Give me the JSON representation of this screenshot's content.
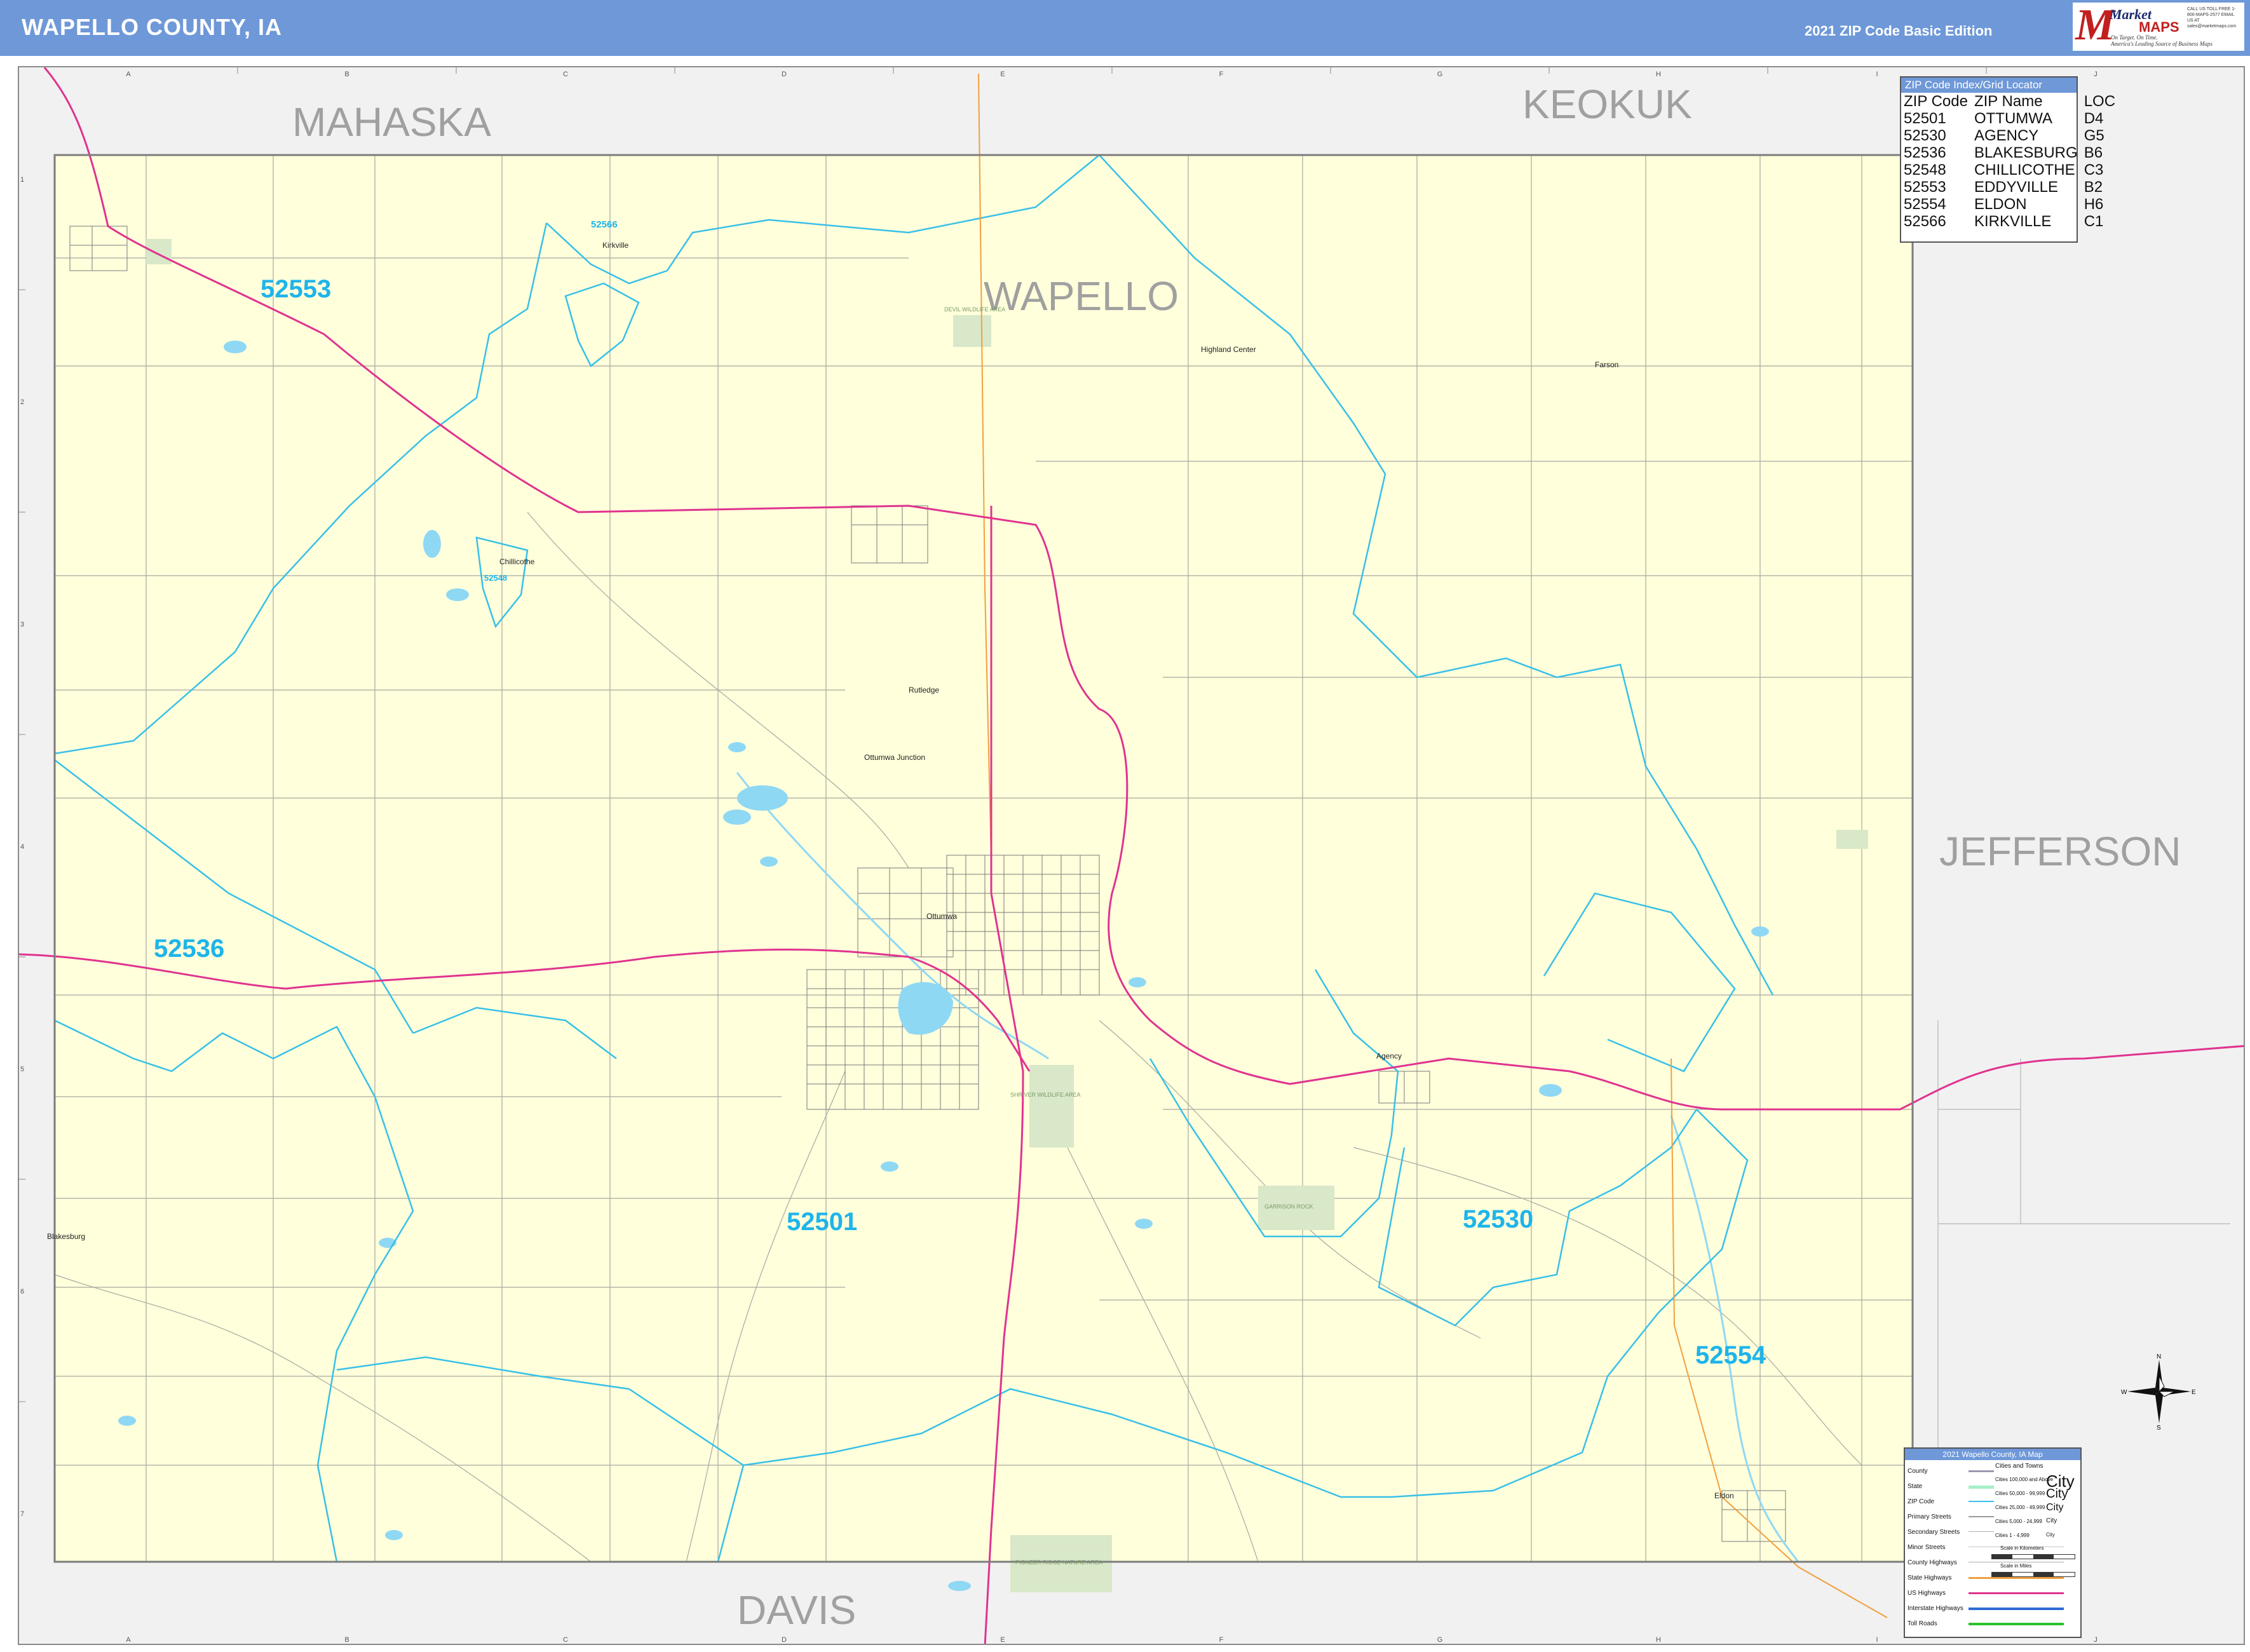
{
  "header": {
    "title": "WAPELLO COUNTY, IA",
    "edition": "2021 ZIP Code Basic Edition",
    "logo": {
      "market": "Market",
      "maps": "MAPS",
      "tagline_1": "On Target. On Time.",
      "tagline_2": "America's Leading Source of Business Maps",
      "contact": "CALL US TOLL FREE 1-800-MAPS-2577 EMAIL US AT sales@marketmaps.com",
      "brand_color": "#c21f1f"
    }
  },
  "colors": {
    "header_bg": "#6e98d8",
    "county_fill": "#ffffdc",
    "outside_fill": "#f1f1f1",
    "zip_boundary": "#38c0e8",
    "zip_label": "#1fb4ea",
    "us_highway": "#e0338f",
    "state_highway": "#f0a040",
    "water": "#8fd8f4",
    "park": "#d8e8c8",
    "street": "#9a9a9a"
  },
  "map": {
    "neighbor_counties": {
      "mahaska": "MAHASKA",
      "keokuk": "KEOKUK",
      "jefferson": "JEFFERSON",
      "davis": "DAVIS"
    },
    "county_label": "WAPELLO",
    "zip_labels": {
      "z52553": "52553",
      "z52536": "52536",
      "z52501": "52501",
      "z52530": "52530",
      "z52554": "52554",
      "z52566": "52566",
      "z52548": "52548"
    },
    "places": {
      "ottumwa": "Ottumwa",
      "rutledge": "Rutledge",
      "ottumwa_junction": "Ottumwa Junction",
      "highland_center": "Highland Center",
      "farson": "Farson",
      "kirkville": "Kirkville",
      "chillicothe": "Chillicothe",
      "agency": "Agency",
      "eldon": "Eldon",
      "blakesburg": "Blakesburg"
    },
    "areas": {
      "garrison": "GARRISON ROCK",
      "pioneer": "PIONEER RIDGE NATURE AREA",
      "wildlife": "SHRIVER WILDLIFE AREA",
      "devil": "DEVIL WILDLIFE AREA"
    },
    "grid_cols": [
      "A",
      "B",
      "C",
      "D",
      "E",
      "F",
      "G",
      "H",
      "I",
      "J"
    ],
    "grid_rows": [
      "1",
      "2",
      "3",
      "4",
      "5",
      "6",
      "7"
    ]
  },
  "zip_index": {
    "title": "ZIP Code Index/Grid Locator",
    "columns": [
      "ZIP Code",
      "ZIP Name",
      "LOC"
    ],
    "rows": [
      [
        "52501",
        "OTTUMWA",
        "D4"
      ],
      [
        "52530",
        "AGENCY",
        "G5"
      ],
      [
        "52536",
        "BLAKESBURG",
        "B6"
      ],
      [
        "52548",
        "CHILLICOTHE",
        "C3"
      ],
      [
        "52553",
        "EDDYVILLE",
        "B2"
      ],
      [
        "52554",
        "ELDON",
        "H6"
      ],
      [
        "52566",
        "KIRKVILLE",
        "C1"
      ]
    ]
  },
  "legend": {
    "title": "2021 Wapello County, IA Map",
    "items": [
      "County",
      "State",
      "ZIP Code",
      "Primary Streets",
      "Secondary Streets",
      "Minor Streets",
      "County Highways",
      "State Highways",
      "US Highways",
      "Interstate Highways",
      "Toll Roads"
    ],
    "towns_title": "Cities and Towns",
    "towns": [
      "Cities 100,000 and Above",
      "Cities 50,000 - 99,999",
      "Cities 25,000 - 49,999",
      "Cities 5,000 - 24,999",
      "Cities 1 - 4,999"
    ],
    "town_symbols": [
      "City",
      "City",
      "City",
      "City",
      "City"
    ],
    "scale_km": "Scale in Kilometers",
    "scale_mi": "Scale in Miles"
  },
  "compass": {
    "n": "N",
    "s": "S",
    "e": "E",
    "w": "W"
  }
}
